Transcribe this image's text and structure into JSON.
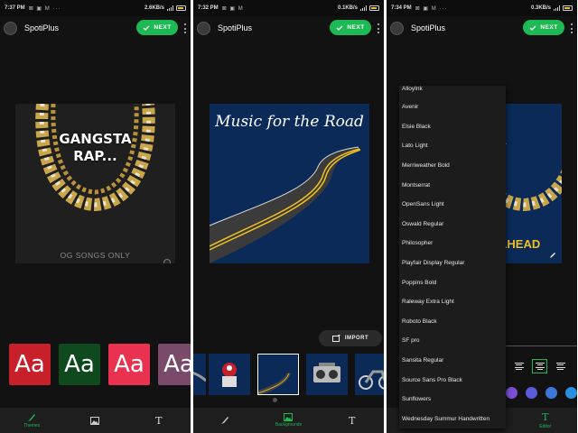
{
  "app_title": "SpotiPlus",
  "next_label": "NEXT",
  "panels": [
    {
      "status": {
        "time": "7:37 PM",
        "icons": "⊠ ▣ M ···",
        "net": "2.6KB/s"
      }
    },
    {
      "status": {
        "time": "7:32 PM",
        "icons": "⊠ ▣ M",
        "net": "0.1KB/s"
      }
    },
    {
      "status": {
        "time": "7:34 PM",
        "icons": "⊠ ▣ M ···",
        "net": "0.3KB/s"
      }
    }
  ],
  "p1": {
    "cover_title_line1": "GANGSTA",
    "cover_title_line2": "RAP...",
    "cover_caption": "OG SONGS ONLY",
    "theme_glyph": "Aa",
    "themes": [
      {
        "color": "#c8202a"
      },
      {
        "color": "#0f4a1e"
      },
      {
        "color": "#e8324f"
      },
      {
        "color": "#7a4a6a"
      }
    ],
    "nav": {
      "themes_label": "Themes"
    }
  },
  "p2": {
    "cover_title": "Music for the Road",
    "import_label": "IMPORT",
    "nav": {
      "backgrounds_label": "Backgrounds"
    }
  },
  "p3": {
    "cover_fragment_top": "a",
    "cover_fragment_bottom": "AHEAD",
    "fonts": [
      "AlloyInk",
      "Avenir",
      "Elsie Black",
      "Lato Light",
      "Merriweather Bold",
      "Montserrat",
      "OpenSans Light",
      "Oswald Regular",
      "Philosopher",
      "Playfair Display Regular",
      "Poppins Bold",
      "Raleway Extra Light",
      "Roboto Black",
      "SF pro",
      "Sansita Regular",
      "Source Sans Pro Black",
      "Sunflowers",
      "Wednesday Summur Handwritten"
    ],
    "colors": [
      "#7b4fd6",
      "#5b5ad8",
      "#3b78d8",
      "#2a8fe0"
    ],
    "nav": {
      "editor_label": "Editor"
    }
  },
  "colors": {
    "accent": "#1db954",
    "background": "#121212"
  }
}
